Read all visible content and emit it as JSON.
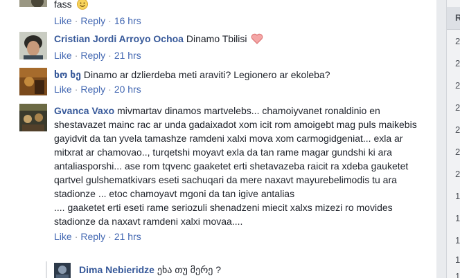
{
  "top_comment": {
    "text": "fass",
    "like": "Like",
    "reply": "Reply",
    "time": "16 hrs"
  },
  "comments": [
    {
      "author": "Cristian Jordi Arroyo Ochoa",
      "text": "Dinamo Tbilisi",
      "like": "Like",
      "reply": "Reply",
      "time": "21 hrs"
    },
    {
      "author": "ხო ხე",
      "text": "Dinamo ar dzlierdeba meti araviti? Legionero ar ekoleba?",
      "like": "Like",
      "reply": "Reply",
      "time": "20 hrs"
    },
    {
      "author": "Gvanca Vaxo",
      "text": "mivmartav dinamos martvelebs... chamoiyvanet ronaldinio en shestavazet mainc rac ar unda gadaixadot xom icit rom amoigebt mag puls maikebis gayidvit da tan yvela tamashze ramdeni xalxi mova xom carmogidgeniat... exla ar mitxrat ar chamovao.., turqetshi moyavt exla da tan rame magar gundshi ki ara antaliasporshi... ase rom tqvenc gaaketet erti shetavazeba raicit ra xdeba gauketet qartvel gulshematkivars eseti sachuqari da mere naxavt mayurebelimodis tu ara stadionze ... etoc chamoyavt mgoni da tan igive antalias",
      "text2": ".... gaaketet erti eseti rame seriozuli shenadzeni miecit xalxs mizezi ro movides stadionze da naxavt ramdeni xalxi movaa....",
      "like": "Like",
      "reply": "Reply",
      "time": "21 hrs"
    }
  ],
  "reply": {
    "author": "Dima Nebieridze",
    "text": "ეხა თუ მერე ?"
  },
  "right_column": {
    "header": "R",
    "numbers": [
      "2",
      "2",
      "2",
      "2",
      "2",
      "2",
      "2",
      "1",
      "1",
      "1",
      "1",
      "1"
    ]
  },
  "colors": {
    "author": "#365899",
    "link": "#4267b2",
    "meta": "#90949c",
    "text": "#1d2129"
  }
}
